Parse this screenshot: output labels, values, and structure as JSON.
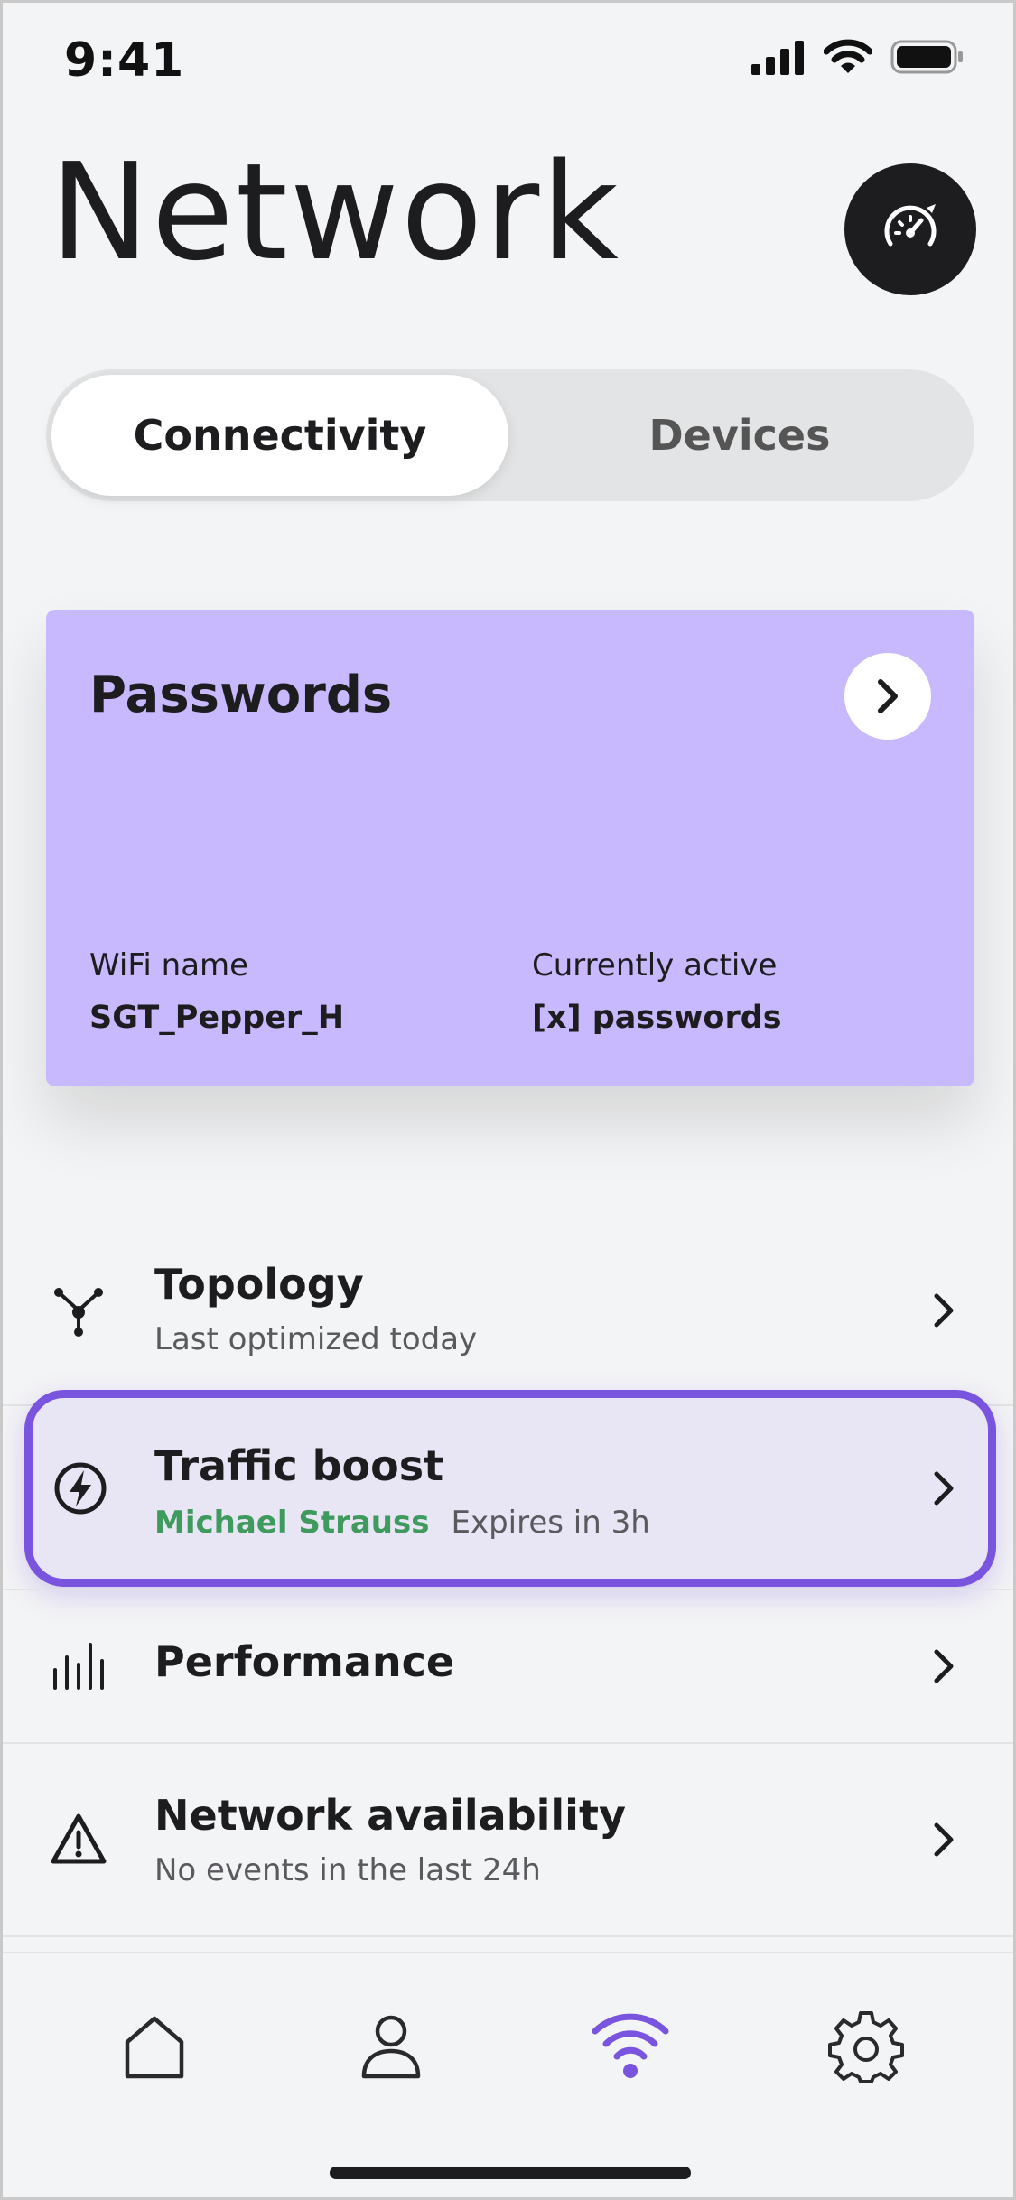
{
  "status_bar": {
    "time": "9:41",
    "signal_icon": "cellular-signal-icon",
    "wifi_icon": "wifi-icon",
    "battery_icon": "battery-icon"
  },
  "header": {
    "title": "Network",
    "speed_test_icon": "speedometer-icon"
  },
  "segmented_control": {
    "tabs": [
      {
        "label": "Connectivity",
        "selected": true
      },
      {
        "label": "Devices",
        "selected": false
      }
    ]
  },
  "passwords_card": {
    "title": "Passwords",
    "arrow_icon": "chevron-right-icon",
    "wifi_label": "WiFi name",
    "wifi_value": "SGT_Pepper_H",
    "active_label": "Currently active",
    "active_value": "[x] passwords",
    "background_color": "#c8b8fe"
  },
  "list": {
    "items": [
      {
        "icon": "topology-icon",
        "title": "Topology",
        "subtitle": "Last optimized today"
      },
      {
        "icon": "lightning-bolt-icon",
        "title": "Traffic boost",
        "subtitle_name": "Michael Strauss",
        "subtitle_detail": "Expires in 3h",
        "highlighted": true
      },
      {
        "icon": "bar-chart-icon",
        "title": "Performance"
      },
      {
        "icon": "warning-triangle-icon",
        "title": "Network availability",
        "subtitle": "No events in the last 24h"
      }
    ]
  },
  "tab_bar": {
    "items": [
      {
        "icon": "home-icon",
        "active": false
      },
      {
        "icon": "user-icon",
        "active": false
      },
      {
        "icon": "wifi-icon",
        "active": true
      },
      {
        "icon": "gear-icon",
        "active": false
      }
    ],
    "active_color": "#7954df"
  },
  "colors": {
    "accent": "#7954df",
    "name_green": "#3f9a5d",
    "background": "#f3f4f5"
  }
}
